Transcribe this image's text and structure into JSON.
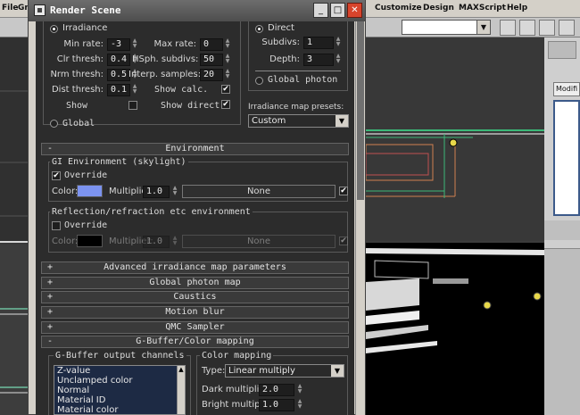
{
  "background": {
    "left_menu": [
      "File",
      "Gro"
    ],
    "menu": [
      "Customize",
      "Design",
      "MAXScript",
      "Help"
    ],
    "modifier_label": "Modifi"
  },
  "dialog": {
    "title": "Render Scene"
  },
  "irradiance": {
    "header": "Irradiance",
    "min_rate_label": "Min rate:",
    "min_rate": "-3",
    "max_rate_label": "Max rate:",
    "max_rate": "0",
    "clr_thresh_label": "Clr thresh:",
    "clr_thresh": "0.4",
    "hsph_label": "HSph. subdivs:",
    "hsph": "50",
    "nrm_thresh_label": "Nrm thresh:",
    "nrm_thresh": "0.5",
    "interp_label": "Interp. samples:",
    "interp": "20",
    "dist_thresh_label": "Dist thresh:",
    "dist_thresh": "0.1",
    "show_calc_label": "Show calc.",
    "show_calc": true,
    "show_label": "Show",
    "show": false,
    "show_direct_label": "Show direct",
    "show_direct": true,
    "global_label": "Global"
  },
  "direct": {
    "header": "Direct",
    "subdivs_label": "Subdivs:",
    "subdivs": "1",
    "depth_label": "Depth:",
    "depth": "3",
    "global_photon_label": "Global photon",
    "presets_label": "Irradiance map presets:",
    "preset": "Custom"
  },
  "environment": {
    "rollout": "Environment",
    "gi_group": "GI Environment (skylight)",
    "gi_override": "Override",
    "gi_override_on": true,
    "gi_color_label": "Color:",
    "gi_color": "#7c93f0",
    "gi_mult_label": "Multiplier:",
    "gi_mult": "1.0",
    "gi_map": "None",
    "rr_group": "Reflection/refraction etc environment",
    "rr_override": "Override",
    "rr_override_on": false,
    "rr_color_label": "Color:",
    "rr_color": "#000000",
    "rr_mult_label": "Multiplier:",
    "rr_mult": "1.0",
    "rr_map": "None"
  },
  "rollouts": [
    {
      "sign": "+",
      "label": "Advanced irradiance map parameters"
    },
    {
      "sign": "+",
      "label": "Global photon map"
    },
    {
      "sign": "+",
      "label": "Caustics"
    },
    {
      "sign": "+",
      "label": "Motion blur"
    },
    {
      "sign": "+",
      "label": "QMC Sampler"
    },
    {
      "sign": "-",
      "label": "G-Buffer/Color mapping"
    }
  ],
  "gbuffer": {
    "channels_title": "G-Buffer output channels",
    "channels": [
      "Z-value",
      "Unclamped color",
      "Normal",
      "Material ID",
      "Material color"
    ],
    "color_mapping_title": "Color mapping",
    "type_label": "Type:",
    "type_value": "Linear multiply",
    "dark_label": "Dark multiplier:",
    "dark": "2.0",
    "bright_label": "Bright multiplier:",
    "bright": "1.0"
  }
}
